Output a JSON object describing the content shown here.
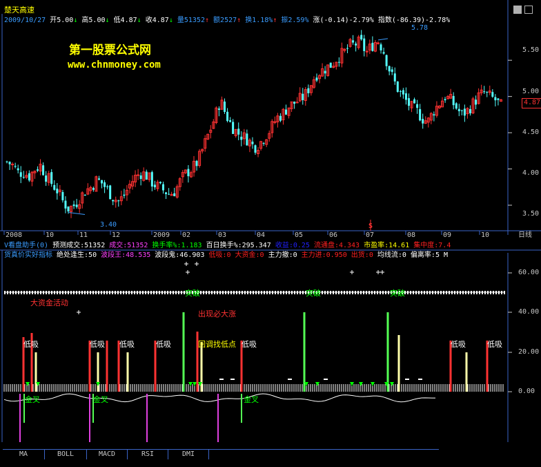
{
  "header": {
    "stock_name": "楚天高速",
    "date": "2009/10/27",
    "open_label": "开5.00",
    "high_label": "高5.00",
    "low_label": "低4.87",
    "close_label": "收4.87",
    "volume_label": "量51352",
    "amount_label": "额2527",
    "turnover_label": "换1.18%",
    "amplitude_label": "振2.59%",
    "change_label": "涨(-0.14)-2.79%",
    "index_label": "指数(-86.39)-2.78%"
  },
  "watermark": {
    "title": "第一股票公式网",
    "url": "www.chnmoney.com"
  },
  "main_chart": {
    "max_label": "5.78",
    "min_label": "3.40",
    "price_tag": "4.87",
    "y_ticks": [
      "5.50",
      "5.00",
      "4.50",
      "4.00",
      "3.50"
    ],
    "x_ticks": [
      "2008",
      "10",
      "11",
      "12",
      "2009",
      "02",
      "03",
      "04",
      "05",
      "06",
      "07",
      "08",
      "09",
      "10"
    ],
    "period_label": "日线",
    "marker": "S"
  },
  "chart_data": {
    "type": "candlestick",
    "ylim": [
      3.3,
      5.95
    ],
    "y_ticks": [
      3.5,
      4.0,
      4.5,
      5.0,
      5.5
    ],
    "annotated_high": 5.78,
    "annotated_low": 3.4,
    "last_close": 4.87,
    "close_path": [
      4.1,
      4.05,
      3.95,
      3.95,
      3.9,
      4.0,
      4.05,
      3.9,
      3.8,
      3.7,
      3.55,
      3.45,
      3.5,
      3.6,
      3.7,
      3.75,
      3.85,
      3.8,
      3.7,
      3.6,
      3.55,
      3.65,
      3.8,
      3.9,
      3.95,
      3.9,
      3.8,
      3.75,
      3.7,
      3.65,
      3.7,
      3.85,
      3.95,
      4.0,
      4.1,
      4.3,
      4.5,
      4.7,
      4.95,
      4.75,
      4.6,
      4.5,
      4.45,
      4.4,
      4.3,
      4.35,
      4.45,
      4.55,
      4.7,
      4.75,
      4.85,
      4.9,
      4.95,
      5.0,
      5.15,
      5.3,
      5.35,
      5.4,
      5.45,
      5.55,
      5.6,
      5.7,
      5.72,
      5.75,
      5.6,
      5.7,
      5.78,
      5.65,
      5.4,
      5.2,
      5.05,
      4.95,
      4.85,
      4.8,
      4.7,
      4.65,
      4.8,
      4.9,
      5.0,
      4.95,
      4.85,
      4.75,
      4.8,
      4.9,
      5.0,
      5.05,
      5.0,
      4.95,
      4.87
    ]
  },
  "panel2": {
    "title": "V看盘助手(0)",
    "items": [
      {
        "text": "预测成交:51352",
        "color": "#ffffff"
      },
      {
        "text": "成交:51352",
        "color": "#ff40ff"
      },
      {
        "text": "换手率%:1.183",
        "color": "#00ff00"
      },
      {
        "text": "百日换手%:295.347",
        "color": "#ffffff"
      },
      {
        "text": "收益:0.25",
        "color": "#2020ff"
      },
      {
        "text": "流通盘:4.343",
        "color": "#ff2020"
      },
      {
        "text": "市盈率:14.61",
        "color": "#ffff00"
      },
      {
        "text": "集中度:7.4",
        "color": "#ff2020"
      }
    ]
  },
  "panel3": {
    "title": "货真价实好指标",
    "items": [
      {
        "text": "绝处逢生:50",
        "color": "#ffffff"
      },
      {
        "text": "波段王:48.535",
        "color": "#ff40ff"
      },
      {
        "text": "波段鬼:46.903",
        "color": "#ffffff"
      },
      {
        "text": "低吸:0",
        "color": "#ff2020"
      },
      {
        "text": "大资金:0",
        "color": "#ff2020"
      },
      {
        "text": "主力撤:0",
        "color": "#ffffff"
      },
      {
        "text": "主力进:0.950",
        "color": "#ff2020"
      },
      {
        "text": "出货:0",
        "color": "#ff2020"
      },
      {
        "text": "均线流:0",
        "color": "#ffffff"
      },
      {
        "text": "偏离率:5",
        "color": "#ffffff"
      },
      {
        "text": "M",
        "color": "#ffffff"
      }
    ],
    "y_ticks": [
      "60.00",
      "40.00",
      "20.00",
      "0.00"
    ],
    "labels": {
      "big_fund": "大资金活动",
      "must_rise": "出现必大涨",
      "buy_low_pullback": "回调找低点",
      "breakout": "突破",
      "low_buy": "低吸",
      "golden_cross": "金叉"
    }
  },
  "tabs": [
    "MA",
    "BOLL",
    "MACD",
    "RSI",
    "DMI"
  ],
  "colors": {
    "up": "#ff3232",
    "down": "#54ffff",
    "grid": "#3a64c8",
    "axis": "#c8c8c8"
  }
}
